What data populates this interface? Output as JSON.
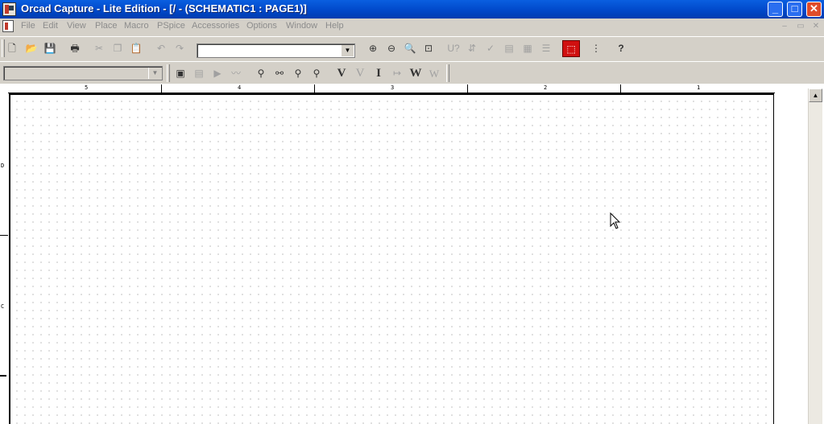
{
  "window": {
    "title": "Orcad Capture - Lite Edition - [/ - (SCHEMATIC1 : PAGE1)]",
    "buttons": {
      "minimize": "_",
      "maximize": "□",
      "close": "✕"
    }
  },
  "menu": {
    "items": [
      "File",
      "Edit",
      "View",
      "Place",
      "Macro",
      "PSpice",
      "Accessories",
      "Options",
      "Window",
      "Help"
    ],
    "mdi": {
      "minimize": "–",
      "restore": "▭",
      "close": "✕"
    }
  },
  "toolbar1": {
    "buttons": [
      {
        "name": "new-icon",
        "glyph": "🗋"
      },
      {
        "name": "open-icon",
        "glyph": "📂"
      },
      {
        "name": "save-icon",
        "glyph": "💾"
      },
      {
        "name": "print-icon",
        "glyph": "🖶"
      },
      {
        "name": "cut-icon",
        "glyph": "✂"
      },
      {
        "name": "copy-icon",
        "glyph": "❐"
      },
      {
        "name": "paste-icon",
        "glyph": "📋"
      },
      {
        "name": "undo-icon",
        "glyph": "↶"
      },
      {
        "name": "redo-icon",
        "glyph": "↷"
      }
    ],
    "part_combo_value": "",
    "zoom_buttons": [
      {
        "name": "zoom-in-icon",
        "glyph": "⊕"
      },
      {
        "name": "zoom-out-icon",
        "glyph": "⊖"
      },
      {
        "name": "zoom-area-icon",
        "glyph": "🔍"
      },
      {
        "name": "zoom-all-icon",
        "glyph": "⊡"
      }
    ],
    "tool_buttons": [
      {
        "name": "annotate-icon",
        "glyph": "U?"
      },
      {
        "name": "back-annotate-icon",
        "glyph": "⇵"
      },
      {
        "name": "drc-icon",
        "glyph": "✓"
      },
      {
        "name": "netlist-icon",
        "glyph": "▤"
      },
      {
        "name": "cross-reference-icon",
        "glyph": "▦"
      },
      {
        "name": "bill-of-materials-icon",
        "glyph": "☰"
      },
      {
        "name": "snap-to-grid-icon",
        "glyph": "⬚"
      },
      {
        "name": "project-manager-icon",
        "glyph": "⋮"
      },
      {
        "name": "help-icon",
        "glyph": "?"
      }
    ]
  },
  "toolbar2": {
    "profile_combo_value": "",
    "buttons": [
      {
        "name": "new-simulation-profile-icon",
        "glyph": "▣"
      },
      {
        "name": "edit-simulation-settings-icon",
        "glyph": "▤"
      },
      {
        "name": "run-pspice-icon",
        "glyph": "▶"
      },
      {
        "name": "view-simulation-results-icon",
        "glyph": "〰"
      },
      {
        "name": "advanced-analysis-icon",
        "glyph": "⚲"
      },
      {
        "name": "parametric-icon",
        "glyph": "⚯"
      },
      {
        "name": "sensitivity-icon",
        "glyph": "⚲"
      },
      {
        "name": "monte-carlo-icon",
        "glyph": "⚲"
      },
      {
        "name": "voltage-marker-icon",
        "glyph": "V"
      },
      {
        "name": "differential-marker-icon",
        "glyph": "V"
      },
      {
        "name": "current-marker-icon",
        "glyph": "I"
      },
      {
        "name": "bias-current-icon",
        "glyph": "↦"
      },
      {
        "name": "power-marker-icon",
        "glyph": "W"
      },
      {
        "name": "enable-bias-icon",
        "glyph": "W"
      }
    ]
  },
  "schematic": {
    "top_ruler_labels": [
      "5",
      "4",
      "3",
      "2",
      "1"
    ],
    "side_ruler_labels": [
      "D",
      "C"
    ]
  },
  "colors": {
    "title_bar": "#0047c8",
    "chrome": "#d4d0c8",
    "record_button": "#d01010"
  }
}
